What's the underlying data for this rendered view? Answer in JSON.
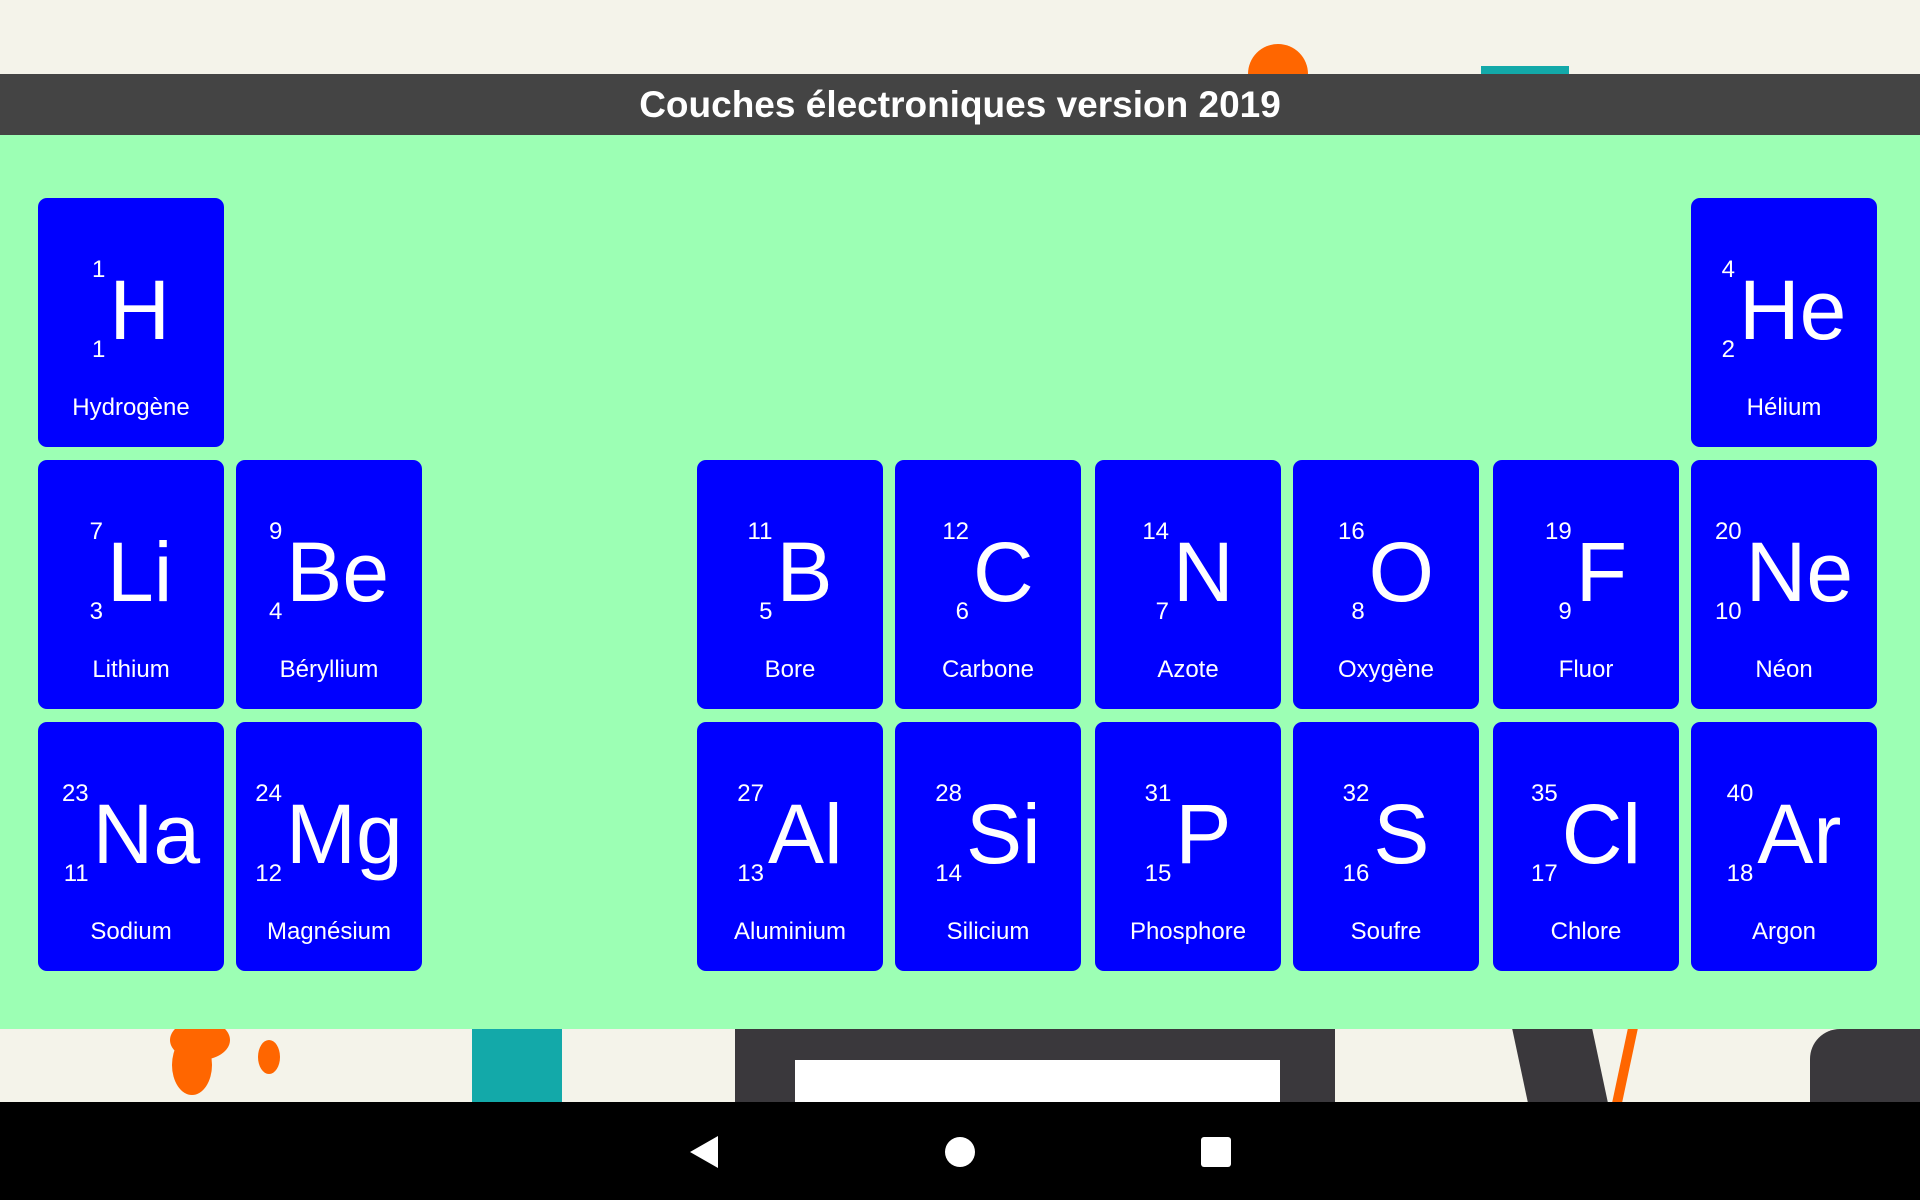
{
  "app": {
    "title": "Couches électroniques version 2019"
  },
  "colors": {
    "tile": "#0000ff",
    "panel": "#9cffb4",
    "titlebar": "#444444"
  },
  "elements": [
    {
      "symbol": "H",
      "name": "Hydrogène",
      "mass": "1",
      "number": "1",
      "row": 0,
      "col": 0
    },
    {
      "symbol": "He",
      "name": "Hélium",
      "mass": "4",
      "number": "2",
      "row": 0,
      "col": 7
    },
    {
      "symbol": "Li",
      "name": "Lithium",
      "mass": "7",
      "number": "3",
      "row": 1,
      "col": 0
    },
    {
      "symbol": "Be",
      "name": "Béryllium",
      "mass": "9",
      "number": "4",
      "row": 1,
      "col": 1
    },
    {
      "symbol": "B",
      "name": "Bore",
      "mass": "11",
      "number": "5",
      "row": 1,
      "col": 2
    },
    {
      "symbol": "C",
      "name": "Carbone",
      "mass": "12",
      "number": "6",
      "row": 1,
      "col": 3
    },
    {
      "symbol": "N",
      "name": "Azote",
      "mass": "14",
      "number": "7",
      "row": 1,
      "col": 4
    },
    {
      "symbol": "O",
      "name": "Oxygène",
      "mass": "16",
      "number": "8",
      "row": 1,
      "col": 5
    },
    {
      "symbol": "F",
      "name": "Fluor",
      "mass": "19",
      "number": "9",
      "row": 1,
      "col": 6
    },
    {
      "symbol": "Ne",
      "name": "Néon",
      "mass": "20",
      "number": "10",
      "row": 1,
      "col": 7
    },
    {
      "symbol": "Na",
      "name": "Sodium",
      "mass": "23",
      "number": "11",
      "row": 2,
      "col": 0
    },
    {
      "symbol": "Mg",
      "name": "Magnésium",
      "mass": "24",
      "number": "12",
      "row": 2,
      "col": 1
    },
    {
      "symbol": "Al",
      "name": "Aluminium",
      "mass": "27",
      "number": "13",
      "row": 2,
      "col": 2
    },
    {
      "symbol": "Si",
      "name": "Silicium",
      "mass": "28",
      "number": "14",
      "row": 2,
      "col": 3
    },
    {
      "symbol": "P",
      "name": "Phosphore",
      "mass": "31",
      "number": "15",
      "row": 2,
      "col": 4
    },
    {
      "symbol": "S",
      "name": "Soufre",
      "mass": "32",
      "number": "16",
      "row": 2,
      "col": 5
    },
    {
      "symbol": "Cl",
      "name": "Chlore",
      "mass": "35",
      "number": "17",
      "row": 2,
      "col": 6
    },
    {
      "symbol": "Ar",
      "name": "Argon",
      "mass": "40",
      "number": "18",
      "row": 2,
      "col": 7
    }
  ],
  "navbar": {
    "icons": [
      "back-icon",
      "home-icon",
      "recents-icon"
    ]
  }
}
